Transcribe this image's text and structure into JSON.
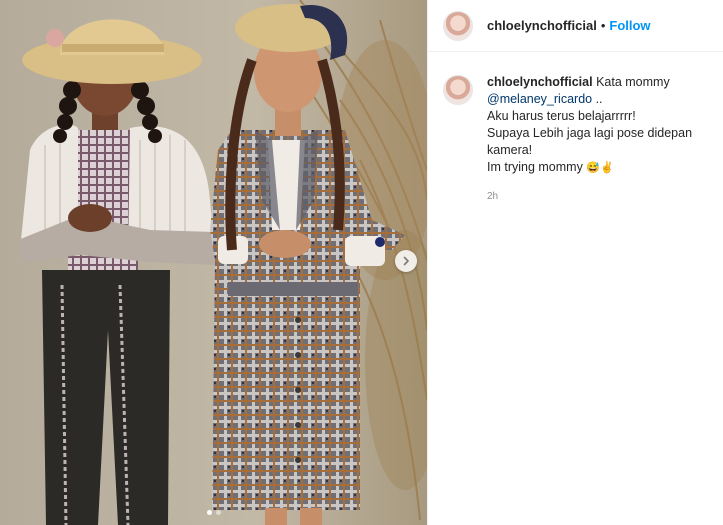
{
  "post": {
    "media": {
      "next_icon": "chevron-right-icon",
      "carousel_dots": [
        {
          "active": true
        },
        {
          "active": false
        }
      ]
    },
    "header": {
      "username": "chloelynchofficial",
      "separator": "•",
      "follow_label": "Follow",
      "follow_color": "#0095f6"
    },
    "caption": {
      "username": "chloelynchofficial",
      "text_intro": " Kata mommy",
      "mention": "@melaney_ricardo",
      "text_after_mention": " ..",
      "lines": [
        "Aku harus terus belajarrrrr!",
        "Supaya Lebih jaga lagi pose didepan kamera!",
        "Im trying mommy "
      ],
      "emojis": "😅✌",
      "time": "2h"
    }
  }
}
